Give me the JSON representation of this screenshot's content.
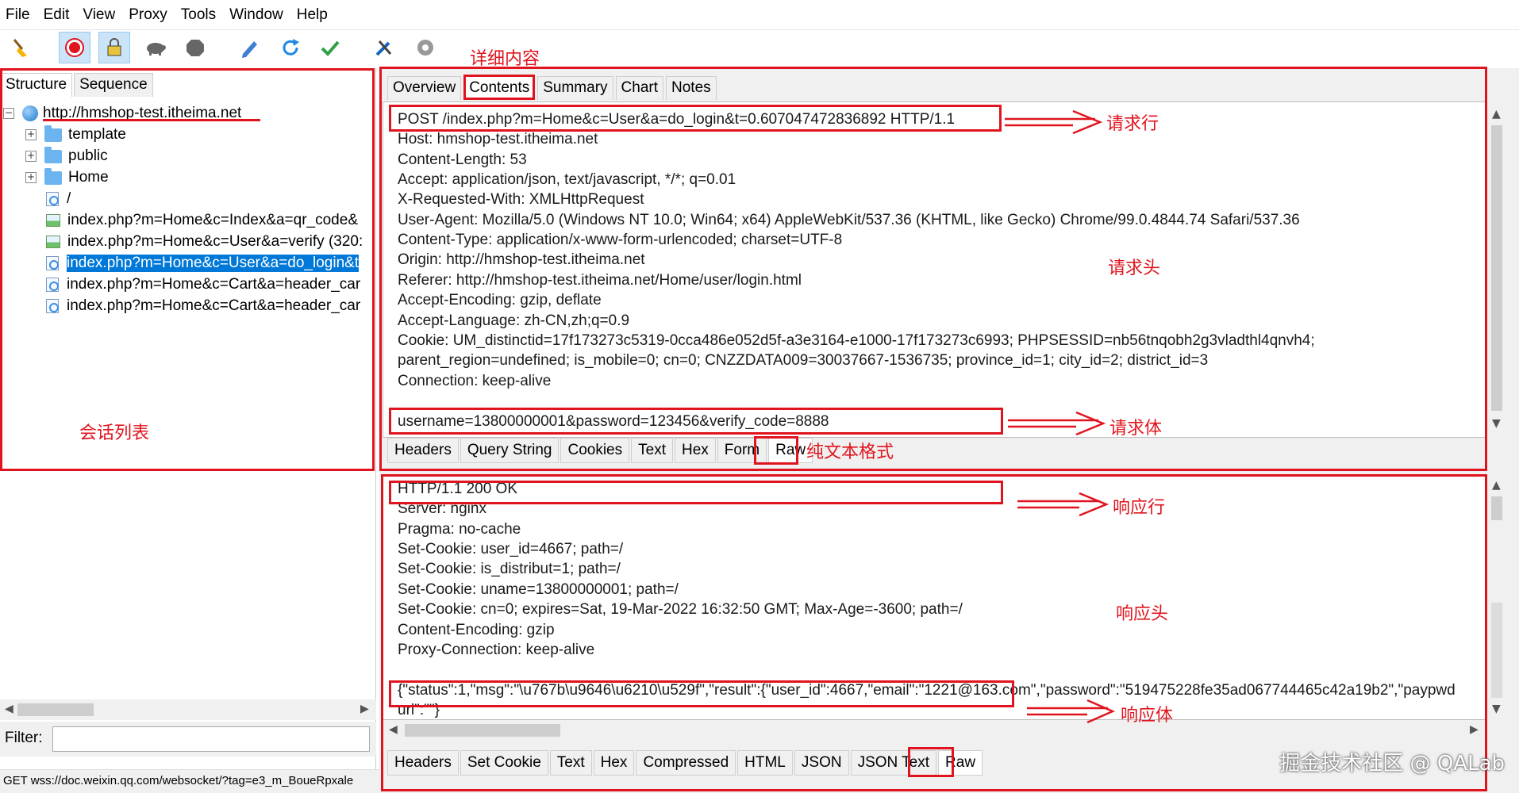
{
  "menu": [
    "File",
    "Edit",
    "View",
    "Proxy",
    "Tools",
    "Window",
    "Help"
  ],
  "toolbar_icons": [
    "broom-icon",
    "record-icon",
    "ssl-proxy-icon",
    "throttle-icon",
    "breakpoint-icon",
    "compose-icon",
    "repeat-icon",
    "validate-icon",
    "tools-icon",
    "settings-icon"
  ],
  "left": {
    "tabs": [
      "Structure",
      "Sequence"
    ],
    "tree": [
      {
        "label": "http://hmshop-test.itheima.net",
        "icon": "globe-icon",
        "expander": "−"
      },
      {
        "label": "template",
        "icon": "folder-icon",
        "expander": "+"
      },
      {
        "label": "public",
        "icon": "folder-icon",
        "expander": "+"
      },
      {
        "label": "Home",
        "icon": "folder-icon",
        "expander": "+"
      },
      {
        "label": "/",
        "icon": "page-icon"
      },
      {
        "label": "index.php?m=Home&c=Index&a=qr_code&",
        "icon": "image-icon"
      },
      {
        "label": "index.php?m=Home&c=User&a=verify (320:",
        "icon": "image-icon"
      },
      {
        "label": "index.php?m=Home&c=User&a=do_login&t",
        "icon": "page-icon",
        "selected": true
      },
      {
        "label": "index.php?m=Home&c=Cart&a=header_car",
        "icon": "page-icon"
      },
      {
        "label": "index.php?m=Home&c=Cart&a=header_car",
        "icon": "page-icon"
      }
    ],
    "filter_label": "Filter:",
    "status": "GET wss://doc.weixin.qq.com/websocket/?tag=e3_m_BoueRpxale"
  },
  "right": {
    "tabs": [
      "Overview",
      "Contents",
      "Summary",
      "Chart",
      "Notes"
    ],
    "request_lines": [
      "POST /index.php?m=Home&c=User&a=do_login&t=0.607047472836892 HTTP/1.1",
      "Host: hmshop-test.itheima.net",
      "Content-Length: 53",
      "Accept: application/json, text/javascript, */*; q=0.01",
      "X-Requested-With: XMLHttpRequest",
      "User-Agent: Mozilla/5.0 (Windows NT 10.0; Win64; x64) AppleWebKit/537.36 (KHTML, like Gecko) Chrome/99.0.4844.74 Safari/537.36",
      "Content-Type: application/x-www-form-urlencoded; charset=UTF-8",
      "Origin: http://hmshop-test.itheima.net",
      "Referer: http://hmshop-test.itheima.net/Home/user/login.html",
      "Accept-Encoding: gzip, deflate",
      "Accept-Language: zh-CN,zh;q=0.9",
      "Cookie: UM_distinctid=17f173273c5319-0cca486e052d5f-a3e3164-e1000-17f173273c6993; PHPSESSID=nb56tnqobh2g3vladthl4qnvh4;",
      "parent_region=undefined; is_mobile=0; cn=0; CNZZDATA009=30037667-1536735; province_id=1; city_id=2; district_id=3",
      "Connection: keep-alive",
      "",
      "username=13800000001&password=123456&verify_code=8888"
    ],
    "request_subtabs": [
      "Headers",
      "Query String",
      "Cookies",
      "Text",
      "Hex",
      "Form",
      "Raw"
    ],
    "response_lines": [
      "HTTP/1.1 200 OK",
      "Server: nginx",
      "Pragma: no-cache",
      "Set-Cookie: user_id=4667; path=/",
      "Set-Cookie: is_distribut=1; path=/",
      "Set-Cookie: uname=13800000001; path=/",
      "Set-Cookie: cn=0; expires=Sat, 19-Mar-2022 16:32:50 GMT; Max-Age=-3600; path=/",
      "Content-Encoding: gzip",
      "Proxy-Connection: keep-alive",
      "",
      "{\"status\":1,\"msg\":\"\\u767b\\u9646\\u6210\\u529f\",\"result\":{\"user_id\":4667,\"email\":\"1221@163.com\",\"password\":\"519475228fe35ad067744465c42a19b2\",\"paypwd",
      "url\":\"\"}"
    ],
    "response_subtabs": [
      "Headers",
      "Set Cookie",
      "Text",
      "Hex",
      "Compressed",
      "HTML",
      "JSON",
      "JSON Text",
      "Raw"
    ]
  },
  "annotations": {
    "details": "详细内容",
    "session_list": "会话列表",
    "request_line": "请求行",
    "request_headers": "请求头",
    "request_body": "请求体",
    "plain_text": "纯文本格式",
    "response_line": "响应行",
    "response_headers": "响应头",
    "response_body": "响应体"
  },
  "watermark": "掘金技术社区 @ QALab",
  "colors": {
    "annotation": "#e0141e",
    "selection": "#0078d7",
    "folder": "#6cb4ef"
  }
}
